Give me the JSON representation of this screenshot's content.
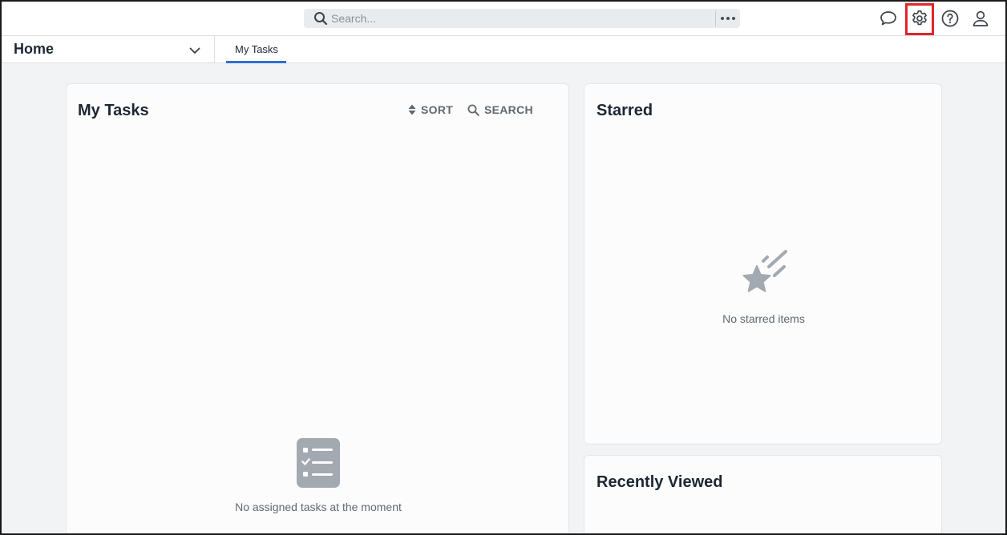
{
  "topbar": {
    "search_placeholder": "Search...",
    "icons": [
      "search-icon",
      "more-options-icon",
      "chat-bubble-icon",
      "gear-icon",
      "help-circle-icon",
      "user-icon"
    ]
  },
  "navbar": {
    "workspace": "Home",
    "tabs": [
      {
        "label": "My Tasks",
        "active": true
      }
    ]
  },
  "my_tasks": {
    "title": "My Tasks",
    "sort_label": "SORT",
    "search_label": "SEARCH",
    "empty_message": "No assigned tasks at the moment"
  },
  "starred": {
    "title": "Starred",
    "empty_message": "No starred items"
  },
  "recently_viewed": {
    "title": "Recently Viewed"
  },
  "colors": {
    "accent": "#2f6fd1",
    "highlight": "#e0262b",
    "background": "#f1f3f5",
    "empty_icon": "#a3a9b0"
  }
}
